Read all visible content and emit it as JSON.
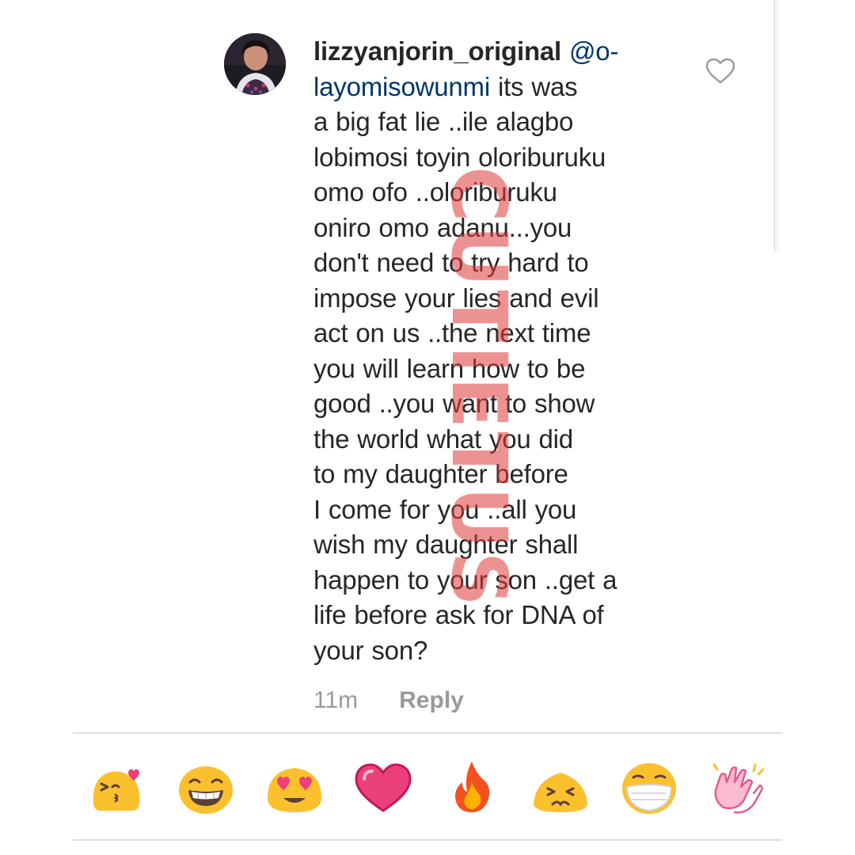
{
  "comment": {
    "username": "lizzyanjorin_original",
    "mention": "@o-layomisowunmi",
    "mention_line1": "@o-",
    "mention_line2": "layomisowunmi",
    "text_lines": [
      "its was",
      "a big  fat lie ..ile  alagbo",
      "lobimosi toyin oloriburuku",
      "omo ofo ..oloriburuku",
      "oniro omo adanu...you",
      "don't need to try hard to",
      "impose your lies and evil",
      "act on us ..the next time",
      "you will learn how to be",
      "good ..you want to show",
      "the world what you did",
      "to my daughter before",
      "I come for you ..all you",
      "wish my daughter shall",
      "happen to your son ..get a",
      "life before ask for DNA of",
      "your son?"
    ],
    "time": "11m",
    "reply_label": "Reply",
    "like_icon": "heart-outline-icon"
  },
  "watermark": {
    "text": "CUTIETUS",
    "color": "#e03a3a"
  },
  "emoji_bar": {
    "items": [
      {
        "name": "kissing-heart-emoji"
      },
      {
        "name": "grinning-emoji"
      },
      {
        "name": "heart-eyes-emoji"
      },
      {
        "name": "pink-heart-emoji"
      },
      {
        "name": "fire-emoji"
      },
      {
        "name": "persevering-emoji"
      },
      {
        "name": "medical-mask-emoji"
      },
      {
        "name": "clapping-hands-emoji"
      }
    ]
  },
  "colors": {
    "text": "#262626",
    "mention": "#003569",
    "muted": "#999999",
    "emoji_yellow": "#fbc02d"
  }
}
